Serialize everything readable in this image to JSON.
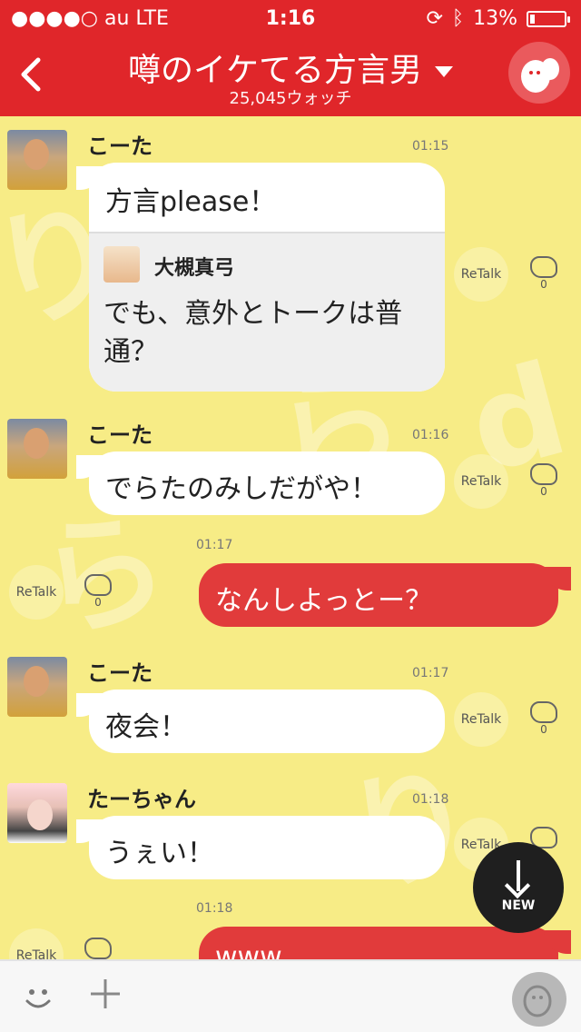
{
  "status_bar": {
    "carrier": "●●●●○ au  LTE",
    "time": "1:16",
    "battery_text": "13%",
    "battery_level": 0.13
  },
  "header": {
    "title": "噂のイケてる方言男",
    "subtitle": "25,045ウォッチ"
  },
  "messages": [
    {
      "sender": "こーた",
      "time": "01:15",
      "text": "方言please！",
      "quote": {
        "sender": "大槻真弓",
        "text": "でも、意外とトークは普通？"
      },
      "retalk": "ReTalk",
      "claps": "0"
    },
    {
      "sender": "こーた",
      "time": "01:16",
      "text": "でらたのみしだがや！",
      "retalk": "ReTalk",
      "claps": "0"
    },
    {
      "time": "01:17",
      "text": "なんしよっとー？",
      "retalk": "ReTalk",
      "claps": "0"
    },
    {
      "sender": "こーた",
      "time": "01:17",
      "text": "夜会！",
      "retalk": "ReTalk",
      "claps": "0"
    },
    {
      "sender": "たーちゃん",
      "time": "01:18",
      "text": "うぇい！",
      "retalk": "ReTalk",
      "claps": "0"
    },
    {
      "time": "01:18",
      "text": "www",
      "retalk": "ReTalk"
    }
  ],
  "new_button": {
    "label": "NEW"
  },
  "input_bar": {
    "icons": [
      "smiley-icon",
      "plus-icon",
      "ghost-icon"
    ]
  },
  "colors": {
    "brand_red": "#e0262a",
    "bubble_red": "#e13b3b",
    "background": "#f7ec86"
  }
}
